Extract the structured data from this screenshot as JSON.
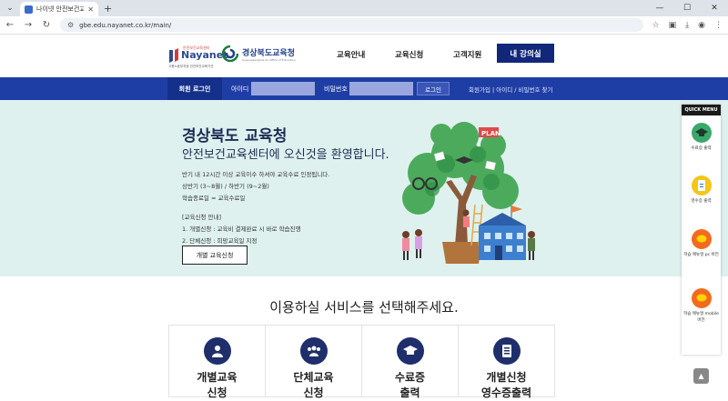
{
  "browser": {
    "tab_title": "나이넷 안전보건교육센터 경상",
    "url": "gbe.edu.nayanet.co.kr/main/"
  },
  "header": {
    "logo_small": "안전보건교육센터",
    "logo_big": "Nayanet",
    "logo_sub": "고용노동부지정 안전보건교육기관",
    "logo2_title": "경상북도교육청",
    "logo2_sub": "Gyeongsangbuk-do Office of Education",
    "menu": [
      "교육안내",
      "교육신청",
      "고객지원"
    ],
    "my_room": "내 강의실"
  },
  "login": {
    "title": "회원 로그인",
    "id_label": "아이디",
    "pw_label": "비밀번호",
    "button": "로그인",
    "links": "회원가입 | 아이디 / 비밀번호 찾기"
  },
  "hero": {
    "title": "경상북도 교육청",
    "subtitle": "안전보건교육센터에 오신것을 환영합니다.",
    "lines": [
      "반기 내 12시간 이상 교육이수 하셔야 교육수료 인정됩니다.",
      "상반기 (3~8월) / 하반기 (9~2월)",
      "학습종료일 = 교육수료일",
      "[교육신청 안내]",
      "1. 개별신청 : 교육비 결제완료 시 바로 학습진행",
      "2. 단체신청 : 희망교육일 지정"
    ],
    "apply_button": "개별 교육신청",
    "plan_flag": "PLAN"
  },
  "quick_menu": {
    "title": "QUICK MENU",
    "items": [
      "수료증 출력",
      "영수증 출력",
      "학습 매뉴얼 pc 버전",
      "학습 매뉴얼 mobile 버전"
    ]
  },
  "services": {
    "title": "이용하실 서비스를 선택해주세요.",
    "cards": [
      "개별교육\n신청",
      "단체교육\n신청",
      "수료증\n출력",
      "개별신청\n영수증출력"
    ]
  },
  "colors": {
    "brand_navy": "#12277a",
    "login_bar": "#1f3ea5",
    "hero_bg": "#dff1ee"
  }
}
